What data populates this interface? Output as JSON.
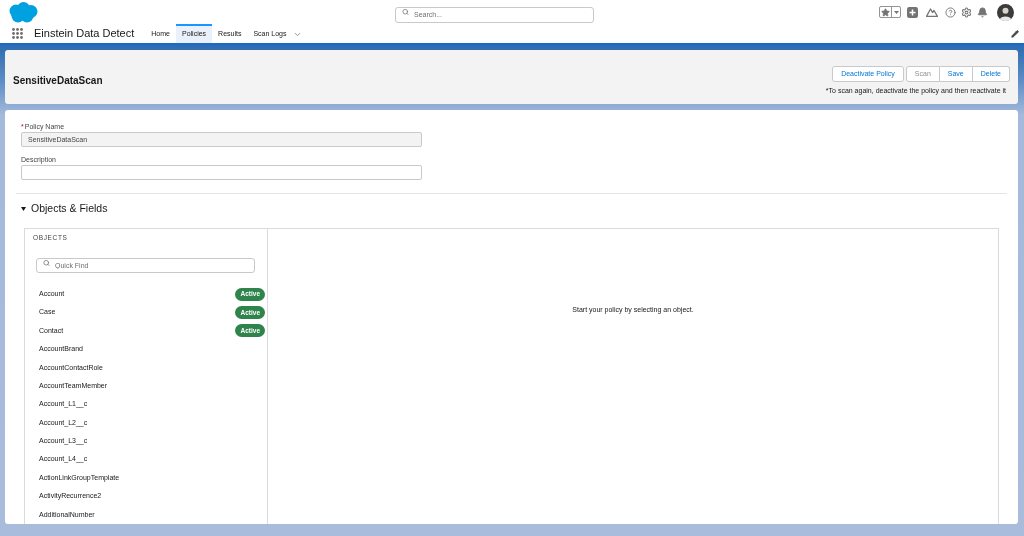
{
  "header": {
    "search": {
      "placeholder": "Search..."
    }
  },
  "nav": {
    "app_name": "Einstein Data Detect",
    "tabs": [
      {
        "label": "Home",
        "selected": false,
        "kind": "page"
      },
      {
        "label": "Policies",
        "selected": true,
        "kind": "page"
      },
      {
        "label": "Results",
        "selected": false,
        "kind": "page"
      },
      {
        "label": "Scan Logs",
        "selected": false,
        "kind": "menu"
      }
    ]
  },
  "record": {
    "title": "SensitiveDataScan",
    "button_groups": [
      [
        {
          "label": "Deactivate Policy",
          "disabled": false
        }
      ],
      [
        {
          "label": "Scan",
          "disabled": true
        },
        {
          "label": "Save",
          "disabled": false
        },
        {
          "label": "Delete",
          "disabled": false
        }
      ]
    ],
    "note": "*To scan again, deactivate the policy and then reactivate it"
  },
  "form": {
    "fields": [
      {
        "label": "Policy Name",
        "required_mark": "*",
        "value": "SensitiveDataScan",
        "disabled": true
      },
      {
        "label": "Description",
        "disabled": false
      }
    ]
  },
  "section": {
    "title": "Objects & Fields",
    "expanded": true,
    "objects_heading": "OBJECTS",
    "quick_find": {
      "placeholder": "Quick Find"
    },
    "objects": [
      {
        "name": "Account",
        "status": "Active"
      },
      {
        "name": "Case",
        "status": "Active"
      },
      {
        "name": "Contact",
        "status": "Active"
      },
      {
        "name": "AccountBrand"
      },
      {
        "name": "AccountContactRole"
      },
      {
        "name": "AccountTeamMember"
      },
      {
        "name": "Account_L1__c"
      },
      {
        "name": "Account_L2__c"
      },
      {
        "name": "Account_L3__c"
      },
      {
        "name": "Account_L4__c"
      },
      {
        "name": "ActionLinkGroupTemplate"
      },
      {
        "name": "ActivityRecurrence2"
      },
      {
        "name": "AdditionalNumber"
      }
    ],
    "empty_message": "Start your policy by selecting an object."
  }
}
